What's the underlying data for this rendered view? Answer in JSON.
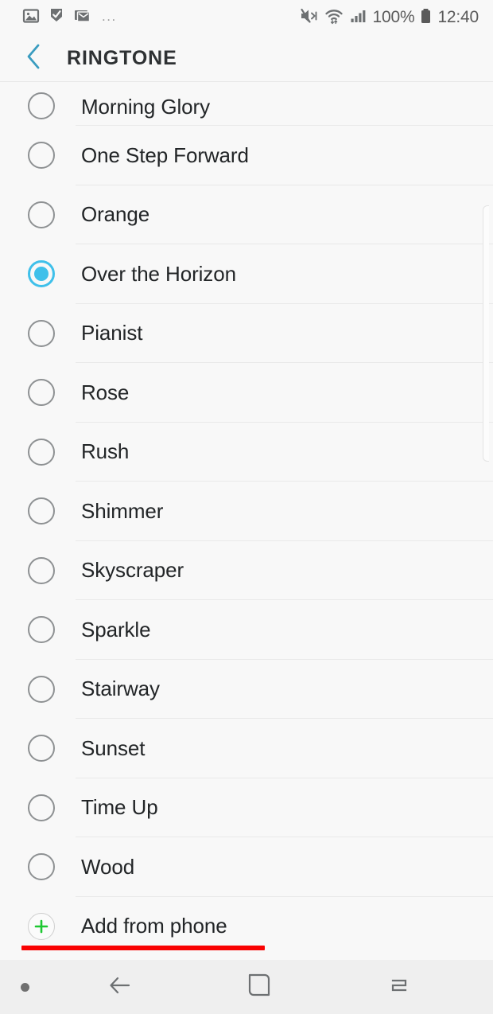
{
  "status_bar": {
    "left_icons": [
      {
        "name": "image-icon",
        "glyph": "photo"
      },
      {
        "name": "flag-check-icon",
        "glyph": "flag"
      },
      {
        "name": "email-stack-icon",
        "glyph": "mail"
      }
    ],
    "overflow": "...",
    "right_icons": [
      {
        "name": "mute-icon"
      },
      {
        "name": "wifi-icon"
      },
      {
        "name": "signal-bars-icon"
      }
    ],
    "battery_percent": "100%",
    "time": "12:40"
  },
  "app_bar": {
    "back_label": "Back",
    "title": "RINGTONE",
    "accent_color": "#3a9cc0"
  },
  "list": {
    "selected_index": 3,
    "items": [
      {
        "label": "Morning Glory",
        "selected": false,
        "clipped": true
      },
      {
        "label": "One Step Forward",
        "selected": false,
        "clipped": false
      },
      {
        "label": "Orange",
        "selected": false,
        "clipped": false
      },
      {
        "label": "Over the Horizon",
        "selected": true,
        "clipped": false
      },
      {
        "label": "Pianist",
        "selected": false,
        "clipped": false
      },
      {
        "label": "Rose",
        "selected": false,
        "clipped": false
      },
      {
        "label": "Rush",
        "selected": false,
        "clipped": false
      },
      {
        "label": "Shimmer",
        "selected": false,
        "clipped": false
      },
      {
        "label": "Skyscraper",
        "selected": false,
        "clipped": false
      },
      {
        "label": "Sparkle",
        "selected": false,
        "clipped": false
      },
      {
        "label": "Stairway",
        "selected": false,
        "clipped": false
      },
      {
        "label": "Sunset",
        "selected": false,
        "clipped": false
      },
      {
        "label": "Time Up",
        "selected": false,
        "clipped": false
      },
      {
        "label": "Wood",
        "selected": false,
        "clipped": false
      }
    ],
    "selected_radio_color": "#3fc0ea",
    "unselected_radio_color": "#8e9193"
  },
  "add_from_phone": {
    "label": "Add from phone",
    "plus_color": "#1ec832"
  },
  "annotation": {
    "underline_color": "#f90202"
  },
  "nav_bar": {
    "dot_label": "",
    "back_label": "Back",
    "home_label": "Home",
    "recents_label": "Recents"
  }
}
